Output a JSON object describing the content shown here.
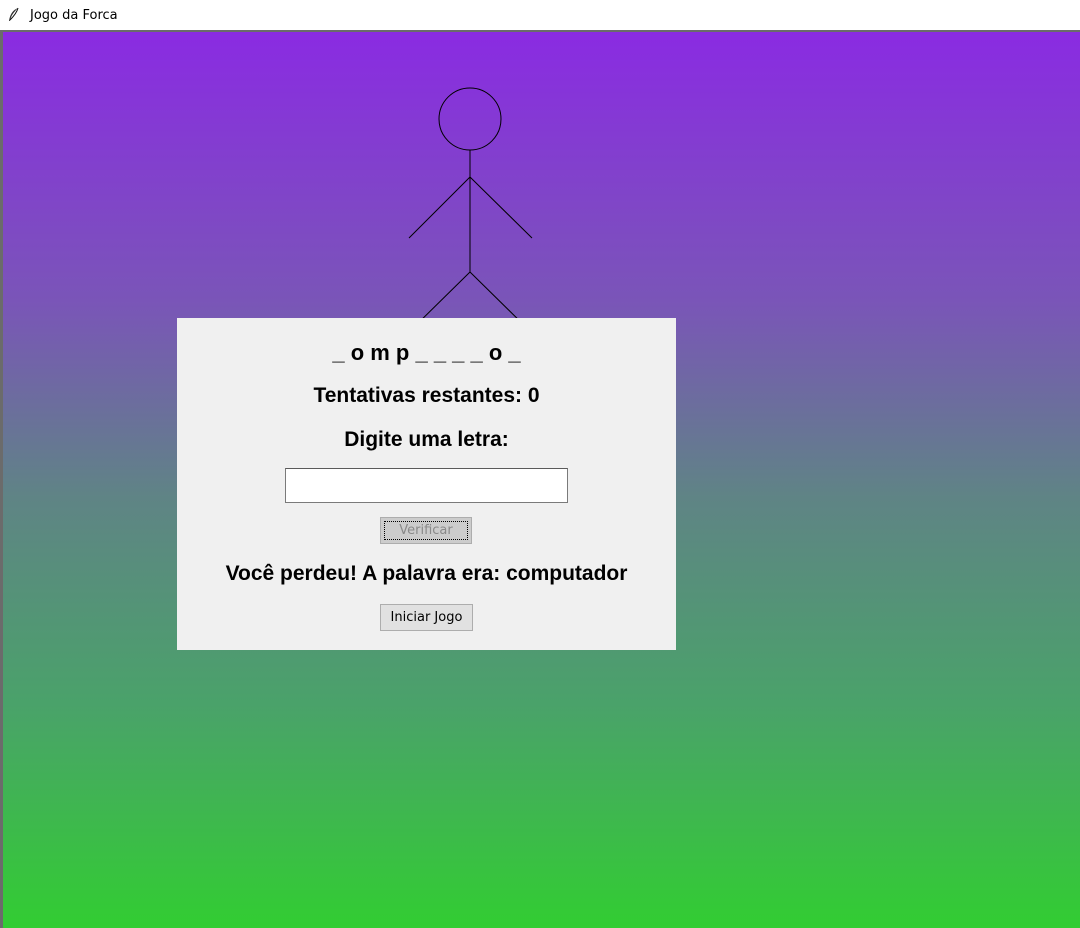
{
  "window": {
    "title": "Jogo da Forca",
    "icon": "feather-icon"
  },
  "game": {
    "word_display": "_ o m p _ _ _ _ o _",
    "attempts_text": "Tentativas restantes: 0",
    "prompt_text": "Digite uma letra:",
    "letter_input": {
      "value": "",
      "placeholder": ""
    },
    "verify_button_label": "Verificar",
    "result_text": "Você perdeu! A palavra era: computador",
    "start_button_label": "Iniciar Jogo"
  },
  "colors": {
    "gradient_top": "#8a2be2",
    "gradient_bottom": "#32cd32",
    "panel_background": "#f0f0f0"
  }
}
